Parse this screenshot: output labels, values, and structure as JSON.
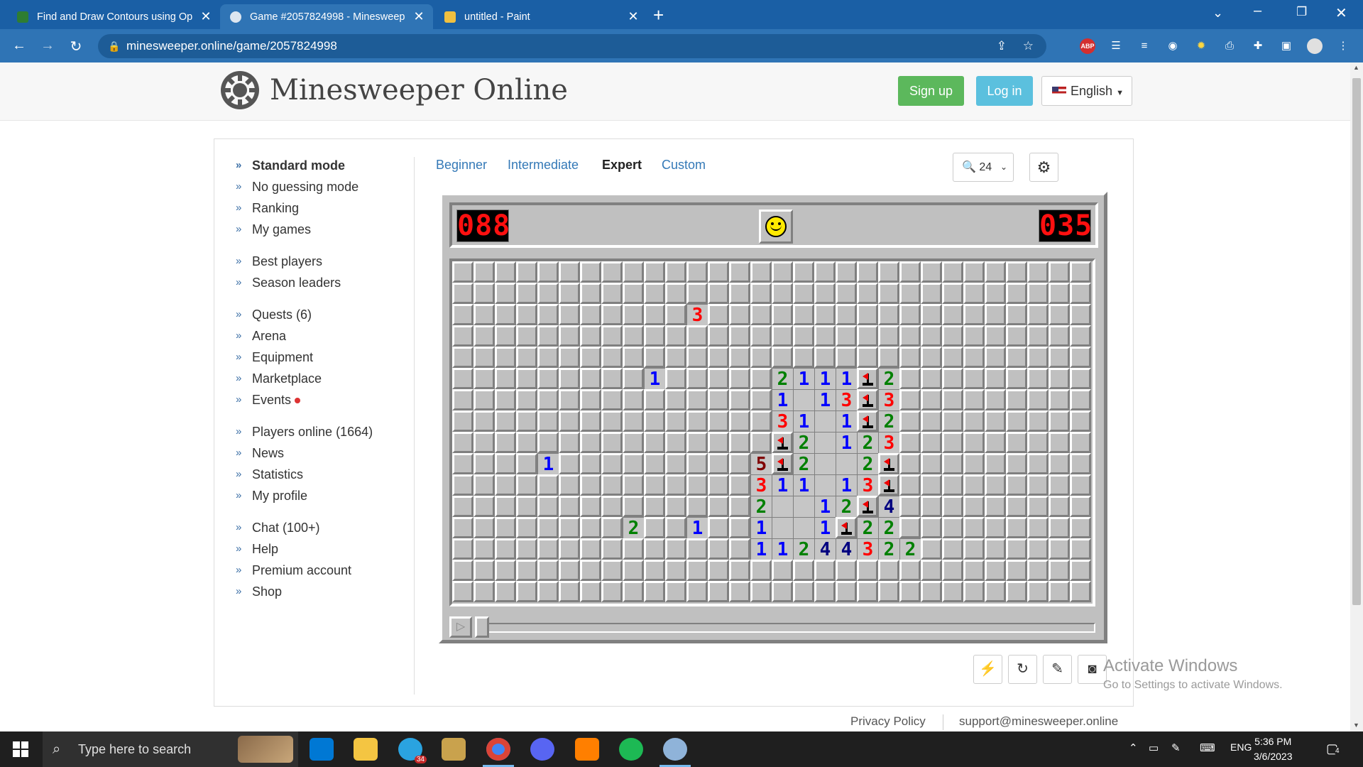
{
  "browser": {
    "tabs": [
      {
        "title": "Find and Draw Contours using Op",
        "favicon_color": "#2e7d32",
        "active": false
      },
      {
        "title": "Game #2057824998 - Minesweep",
        "favicon_color": "#e0e0e0",
        "active": true
      },
      {
        "title": "untitled - Paint",
        "favicon_color": "#f0c040",
        "active": false
      }
    ],
    "new_tab_icon": "plus-icon",
    "url": "minesweeper.online/game/2057824998",
    "extensions": [
      "share-icon",
      "star-icon",
      "abp-icon",
      "list-icon",
      "stack-icon",
      "audio-icon",
      "bulb-icon",
      "print-icon",
      "puzzle-icon",
      "sidepanel-icon",
      "profile-avatar",
      "more-icon"
    ]
  },
  "header": {
    "site_title": "Minesweeper Online",
    "signup_label": "Sign up",
    "login_label": "Log in",
    "language": "English",
    "signup_color": "#5cb85c",
    "login_color": "#5bc0de"
  },
  "sidebar": {
    "groups": [
      [
        {
          "label": "Standard mode",
          "bold": true
        },
        {
          "label": "No guessing mode"
        },
        {
          "label": "Ranking"
        },
        {
          "label": "My games"
        }
      ],
      [
        {
          "label": "Best players"
        },
        {
          "label": "Season leaders"
        }
      ],
      [
        {
          "label": "Quests (6)"
        },
        {
          "label": "Arena"
        },
        {
          "label": "Equipment"
        },
        {
          "label": "Marketplace"
        },
        {
          "label": "Events",
          "dot": true
        }
      ],
      [
        {
          "label": "Players online (1664)"
        },
        {
          "label": "News"
        },
        {
          "label": "Statistics"
        },
        {
          "label": "My profile"
        }
      ],
      [
        {
          "label": "Chat (100+)"
        },
        {
          "label": "Help"
        },
        {
          "label": "Premium account"
        },
        {
          "label": "Shop"
        }
      ]
    ]
  },
  "levels": [
    {
      "label": "Beginner",
      "active": false
    },
    {
      "label": "Intermediate",
      "active": false
    },
    {
      "label": "Expert",
      "active": true
    },
    {
      "label": "Custom",
      "active": false
    }
  ],
  "zoom_value": "24",
  "game": {
    "mines_counter": "088",
    "timer_counter": "035",
    "rows": 16,
    "cols": 30,
    "board": [
      "..............................",
      "..............................",
      "...........3..................",
      "..............................",
      "..............................",
      ".........1.....2111F2.........",
      "...............1 13F3.........",
      "...............31 1F2.........",
      "...............F2 123.........",
      "....1.........5F2  2F.........",
      "..............311 13F.........",
      "..............2  12F4.........",
      "........2..1..1  1F22.........",
      "..............11244322........",
      "..............................",
      ".............................."
    ],
    "number_colors": {
      "1": "#0000ff",
      "2": "#008000",
      "3": "#ff0000",
      "4": "#000080",
      "5": "#800000"
    }
  },
  "tools": [
    "magic-wand-icon",
    "refresh-icon",
    "edit-icon",
    "camera-icon"
  ],
  "watermark": {
    "line1": "Activate Windows",
    "line2": "Go to Settings to activate Windows."
  },
  "footer": {
    "privacy": "Privacy Policy",
    "support": "support@minesweeper.online"
  },
  "taskbar": {
    "search_placeholder": "Type here to search",
    "time": "5:36 PM",
    "date": "3/6/2023",
    "language": "ENG",
    "notifications": "4",
    "telegram_badge": "34",
    "apps": [
      "vscode-icon",
      "explorer-icon",
      "telegram-icon",
      "lol-icon",
      "chrome-icon",
      "discord-icon",
      "vlc-icon",
      "spotify-icon",
      "paint-icon"
    ]
  }
}
